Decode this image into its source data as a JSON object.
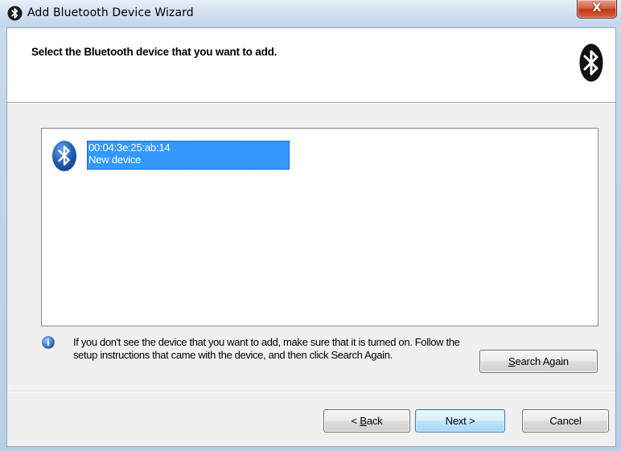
{
  "window": {
    "title": "Add Bluetooth Device Wizard",
    "close_glyph": "X",
    "icon": "bluetooth-icon"
  },
  "header": {
    "instruction": "Select the Bluetooth device that you want to add.",
    "logo_icon": "bluetooth-logo-icon"
  },
  "devices": [
    {
      "address": "00:04:3e:25:ab:14",
      "name": "New device",
      "selected": true,
      "icon": "bluetooth-device-icon"
    }
  ],
  "info": {
    "icon": "info-icon",
    "text": "If you don't see the device that you want to add, make sure that it is turned on. Follow the setup instructions that came with the device, and then click Search Again."
  },
  "buttons": {
    "search_again": {
      "mnemonic": "S",
      "rest": "earch Again"
    },
    "back": {
      "prefix": "< ",
      "mnemonic": "B",
      "rest": "ack"
    },
    "next": {
      "label": "Next >"
    },
    "cancel": {
      "label": "Cancel"
    }
  },
  "colors": {
    "selection": "#3399ff",
    "bluetooth_blue": "#1f5fb5",
    "close_red": "#c23a16"
  }
}
